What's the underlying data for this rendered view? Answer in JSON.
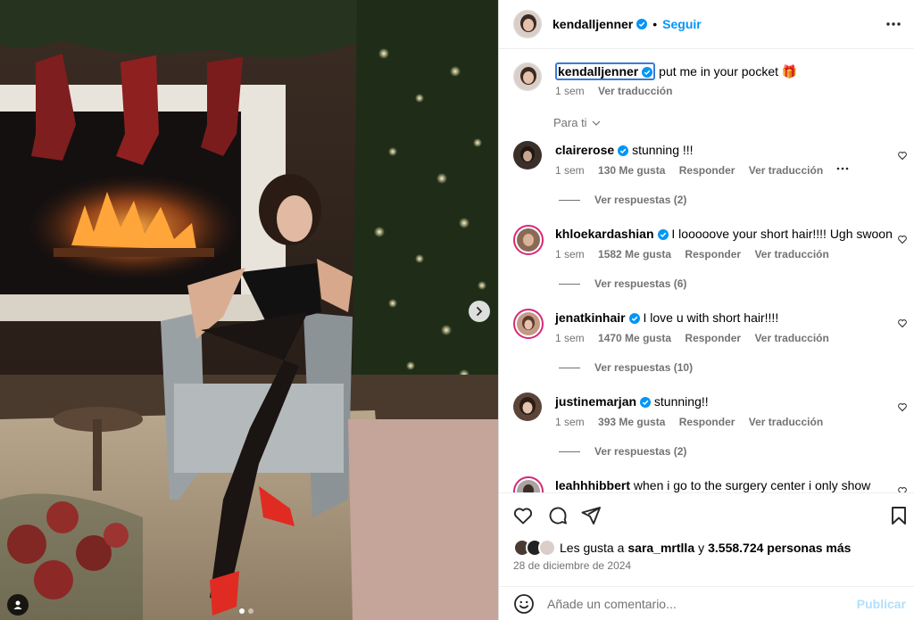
{
  "post": {
    "author": "kendalljenner",
    "follow_label": "Seguir",
    "separator": "•",
    "caption": "put me in your pocket",
    "caption_emoji": "🎁",
    "caption_time": "1 sem",
    "caption_translate": "Ver traducción",
    "sort_label": "Para ti"
  },
  "comments": [
    {
      "user": "clairerose",
      "text": "stunning !!!",
      "time": "1 sem",
      "likes": "130 Me gusta",
      "reply": "Responder",
      "translate": "Ver traducción",
      "replies": "Ver respuestas (2)",
      "avatar_color": "#3b2f2a"
    },
    {
      "user": "khloekardashian",
      "text": "I looooove your short hair!!!! Ugh swoon",
      "time": "1 sem",
      "likes": "1582 Me gusta",
      "reply": "Responder",
      "translate": "Ver traducción",
      "replies": "Ver respuestas (6)",
      "avatar_color": "#8a6a55"
    },
    {
      "user": "jenatkinhair",
      "text": "I love u with short hair!!!!",
      "time": "1 sem",
      "likes": "1470 Me gusta",
      "reply": "Responder",
      "translate": "Ver traducción",
      "replies": "Ver respuestas (10)",
      "avatar_color": "#c39a86"
    },
    {
      "user": "justinemarjan",
      "text": "stunning!!",
      "time": "1 sem",
      "likes": "393 Me gusta",
      "reply": "Responder",
      "translate": "Ver traducción",
      "replies": "Ver respuestas (2)",
      "avatar_color": "#5a4538"
    },
    {
      "user": "leahhhibbert",
      "text": "when i go to the surgery center i only show",
      "avatar_color": "#a9a4a0"
    }
  ],
  "likes_line": {
    "prefix": "Les gusta a",
    "user": "sara_mrtlla",
    "connector": "y",
    "others": "3.558.724 personas más"
  },
  "date": "28 de diciembre de 2024",
  "compose": {
    "placeholder": "Añade un comentario...",
    "post_label": "Publicar"
  },
  "colors": {
    "accent": "#0095f6",
    "verified": "#0095f6",
    "muted": "#737373",
    "story_ring": "#d62976"
  },
  "icons": {
    "like": "heart-icon",
    "comment": "comment-icon",
    "share": "send-icon",
    "save": "bookmark-icon",
    "more": "more-horizontal-icon",
    "emoji": "emoji-icon",
    "next": "chevron-right-icon",
    "tag": "user-tag-icon"
  }
}
